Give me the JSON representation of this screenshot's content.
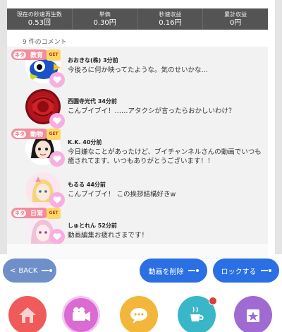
{
  "stats": [
    {
      "label": "現在の秒速再生数",
      "value": "0.53回"
    },
    {
      "label": "単価",
      "value": "0.30円"
    },
    {
      "label": "秒速収益",
      "value": "0.16円"
    },
    {
      "label": "累計収益",
      "value": "0円"
    }
  ],
  "comment_count": "9 件のコメント",
  "tags": {
    "prefix": "ネタ",
    "get": "GET",
    "heart_text": "ありがとう"
  },
  "comments": [
    {
      "name": "おおきな(株) 3分前",
      "body": "今後ろに何か映ってたような。気のせいかな…",
      "tag": "教育"
    },
    {
      "name": "西園寺光代 34分前",
      "body": "こんブイブイ！……アタクシが言ったらおかしいわけ？",
      "tag": ""
    },
    {
      "name": "K.K. 40分前",
      "body": "今日嫌なことがあったけど、ブイチャンネルさんの動画でいつも癒されてます、いつもありがとうございます！！",
      "tag": "動物"
    },
    {
      "name": "もるる 44分前",
      "body": "こんブイブイ！ この挨拶結構好きw",
      "tag": ""
    },
    {
      "name": "しゅとれん 52分前",
      "body": "動画編集お疲れさまです！",
      "tag": "日常"
    }
  ],
  "buttons": {
    "back": "BACK",
    "delete": "動画を削除",
    "lock": "ロックする"
  },
  "nav": [
    {
      "icon": "home-icon",
      "color": "#f05a5a"
    },
    {
      "icon": "video-camera-icon",
      "color": "#d96bd3"
    },
    {
      "icon": "chat-bubble-icon",
      "color": "#f2b73a"
    },
    {
      "icon": "sleep-coffee-icon",
      "color": "#39b7c8"
    },
    {
      "icon": "star-board-icon",
      "color": "#a06ad3"
    }
  ],
  "colors": {
    "accent_blue": "#2a6fe3",
    "back_blue": "#6f8fc9",
    "tag_pink": "#f48c9c",
    "stats_bg": "#545454"
  }
}
